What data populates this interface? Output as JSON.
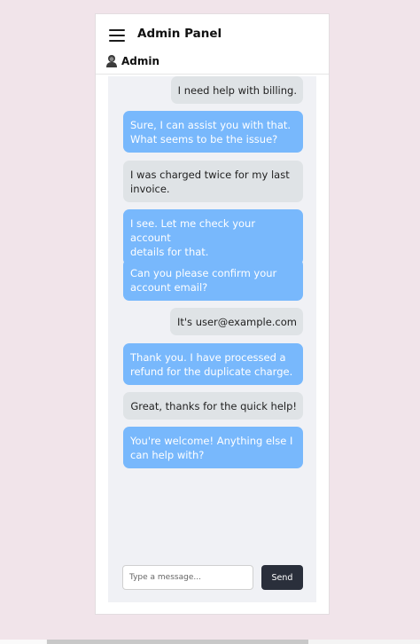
{
  "header": {
    "title": "Admin Panel",
    "user_name": "Admin",
    "menu_icon": "hamburger-menu-icon",
    "user_icon": "user-avatar-icon"
  },
  "messages": [
    {
      "sender": "user",
      "lines": [
        "I need help with billing."
      ]
    },
    {
      "sender": "agent",
      "lines": [
        "Sure, I can assist you with that.",
        "What seems to be the issue?"
      ]
    },
    {
      "sender": "user",
      "lines": [
        "I was charged twice for my last",
        "invoice."
      ]
    },
    {
      "sender": "agent",
      "lines": [
        "I see. Let me check your account",
        "details for that."
      ]
    },
    {
      "sender": "agent",
      "lines": [
        "Can you please confirm your",
        "account email?"
      ]
    },
    {
      "sender": "user",
      "lines": [
        "It's user@example.com"
      ]
    },
    {
      "sender": "agent",
      "lines": [
        "Thank you. I have processed a",
        "refund for the duplicate charge."
      ]
    },
    {
      "sender": "user",
      "lines": [
        "Great, thanks for the quick help!"
      ]
    },
    {
      "sender": "agent",
      "lines": [
        "You're welcome! Anything else I",
        "can help with?"
      ]
    }
  ],
  "composer": {
    "placeholder": "Type a message...",
    "value": "",
    "send_label": "Send"
  },
  "colors": {
    "agent_bubble": "#78b8fc",
    "user_bubble": "#dfe3e6",
    "send_button": "#2a2f3b",
    "page_background": "#f1e4ea"
  }
}
